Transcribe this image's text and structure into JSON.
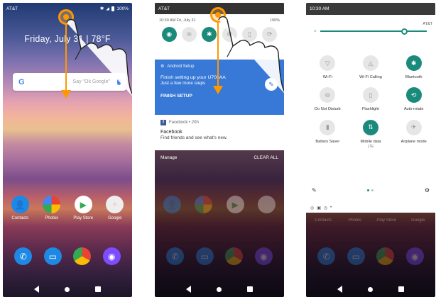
{
  "panel1": {
    "carrier": "AT&T",
    "battery": "100%",
    "date_weather": "Friday, July 31 | 78°F",
    "search_placeholder": "Say \"Ok Google\"",
    "google_letter": "G",
    "apps": [
      {
        "label": "Contacts",
        "icon": "contacts-icon",
        "color": "#1e88e5"
      },
      {
        "label": "Photos",
        "icon": "photos-icon",
        "color": "#ffffff"
      },
      {
        "label": "Play Store",
        "icon": "play-store-icon",
        "color": "#ffffff"
      },
      {
        "label": "Google",
        "icon": "google-folder-icon",
        "color": "#ffffff"
      }
    ],
    "dock": [
      {
        "icon": "phone-icon",
        "color": "#1e88e5"
      },
      {
        "icon": "messages-icon",
        "color": "#1e88e5"
      },
      {
        "icon": "chrome-icon",
        "color": "#ffffff"
      },
      {
        "icon": "camera-icon",
        "color": "#7c4dff"
      }
    ]
  },
  "panel2": {
    "carrier": "AT&T",
    "shade_time": "10:30 AM Fri, July 31",
    "battery": "100%",
    "setup_header": "Android Setup",
    "setup_title": "Finish setting up your U705AA",
    "setup_sub": "Just a few more steps",
    "setup_action": "FINISH SETUP",
    "fb_header": "Facebook • 20h",
    "fb_title": "Facebook",
    "fb_text": "Find friends and see what's new.",
    "manage": "Manage",
    "clear_all": "CLEAR ALL"
  },
  "panel3": {
    "time": "10:30 AM",
    "carrier_small": "AT&T",
    "tiles": [
      {
        "label": "Wi-Fi",
        "sub": "",
        "icon": "wifi-icon",
        "on": false
      },
      {
        "label": "Wi-Fi Calling",
        "sub": "",
        "icon": "wifi-calling-icon",
        "on": false
      },
      {
        "label": "Bluetooth",
        "sub": "",
        "icon": "bluetooth-icon",
        "on": true
      },
      {
        "label": "Do Not Disturb",
        "sub": "",
        "icon": "do-not-disturb-icon",
        "on": false
      },
      {
        "label": "Flashlight",
        "sub": "",
        "icon": "flashlight-icon",
        "on": false
      },
      {
        "label": "Auto-rotate",
        "sub": "",
        "icon": "auto-rotate-icon",
        "on": true
      },
      {
        "label": "Battery Saver",
        "sub": "",
        "icon": "battery-saver-icon",
        "on": false
      },
      {
        "label": "Mobile data",
        "sub": "LTE",
        "icon": "mobile-data-icon",
        "on": true
      },
      {
        "label": "Airplane mode",
        "sub": "",
        "icon": "airplane-icon",
        "on": false
      }
    ],
    "brightness_level": 0.78,
    "ghost_labels": [
      "Contacts",
      "Photos",
      "Play Store",
      "Google"
    ]
  }
}
